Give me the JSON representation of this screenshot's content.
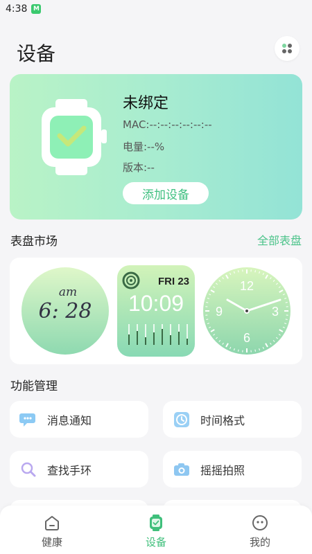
{
  "status_bar": {
    "time": "4:38",
    "badge": "M"
  },
  "header": {
    "title": "设备"
  },
  "device": {
    "name": "未绑定",
    "mac": "MAC:--:--:--:--:--:--",
    "battery": "电量:--%",
    "version": "版本:--",
    "add_button": "添加设备"
  },
  "market": {
    "title": "表盘市场",
    "all_link": "全部表盘",
    "faces": [
      {
        "name": "digital-handwritten",
        "top": "am",
        "time": "6: 28"
      },
      {
        "name": "digital-activity",
        "date": "FRI 23",
        "time": "10:09"
      },
      {
        "name": "analog",
        "numbers": [
          "12",
          "3",
          "6",
          "9"
        ]
      }
    ]
  },
  "functions": {
    "title": "功能管理",
    "items": [
      {
        "label": "消息通知",
        "icon": "message-icon"
      },
      {
        "label": "时间格式",
        "icon": "clock-icon"
      },
      {
        "label": "查找手环",
        "icon": "search-icon"
      },
      {
        "label": "摇摇拍照",
        "icon": "camera-icon"
      }
    ]
  },
  "nav": {
    "items": [
      {
        "label": "健康",
        "icon": "home-icon",
        "active": false
      },
      {
        "label": "设备",
        "icon": "watch-icon",
        "active": true
      },
      {
        "label": "我的",
        "icon": "face-icon",
        "active": false
      }
    ]
  },
  "colors": {
    "accent": "#3fbf7b",
    "card_gradient_start": "#b9f3c6",
    "card_gradient_end": "#93e3d6"
  }
}
